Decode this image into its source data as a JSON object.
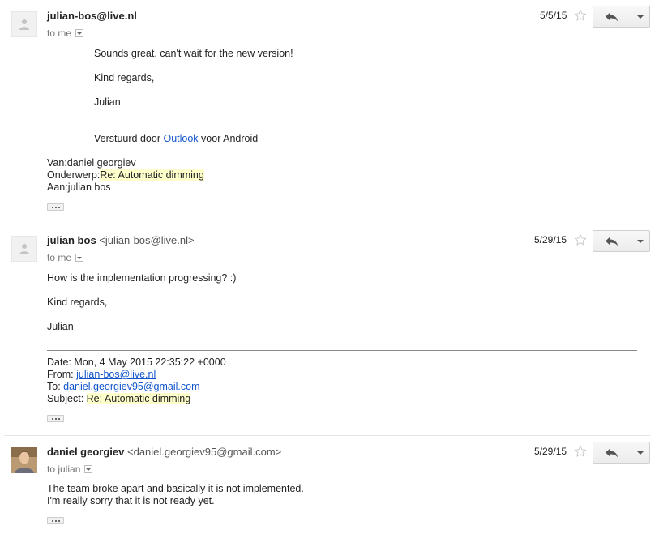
{
  "messages": [
    {
      "sender_name": "julian-bos@live.nl",
      "sender_email": "",
      "recipient": "to me",
      "date": "5/5/15",
      "avatar": "default-person-icon",
      "body": {
        "line1": "Sounds great, can't wait for the new version!",
        "line2": "Kind regards,",
        "line3": "Julian",
        "sent_prefix": "Verstuurd door ",
        "sent_link": "Outlook",
        "sent_suffix": " voor Android",
        "van_label": "Van:",
        "van_value": "daniel georgiev",
        "onderwerp_label": "Onderwerp:",
        "onderwerp_value": "Re: Automatic dimming",
        "aan_label": "Aan:",
        "aan_value": "julian bos"
      }
    },
    {
      "sender_name": "julian bos",
      "sender_email": "<julian-bos@live.nl>",
      "recipient": "to me",
      "date": "5/29/15",
      "avatar": "default-person-icon",
      "body": {
        "line1": "How is the implementation progressing? :)",
        "line2": "Kind regards,",
        "line3": "Julian",
        "date_line": "Date: Mon, 4 May 2015 22:35:22 +0000",
        "from_label": "From: ",
        "from_value": "julian-bos@live.nl",
        "to_label": "To: ",
        "to_value": "daniel.georgiev95@gmail.com",
        "subject_label": "Subject: ",
        "subject_value": "Re: Automatic dimming"
      }
    },
    {
      "sender_name": "daniel georgiev",
      "sender_email": "<daniel.georgiev95@gmail.com>",
      "recipient": "to julian",
      "date": "5/29/15",
      "avatar": "profile-photo",
      "body": {
        "line1": "The team broke apart and basically it is not implemented.",
        "line2": "I'm really sorry that it is not ready yet."
      }
    }
  ],
  "icons": {
    "star": "star-outline-icon",
    "reply": "reply-icon",
    "more": "chevron-down-icon",
    "show_trimmed": "ellipsis-icon"
  },
  "colors": {
    "link": "#1155cc",
    "highlight": "#ffffcc",
    "divider": "#e5e5e5"
  }
}
